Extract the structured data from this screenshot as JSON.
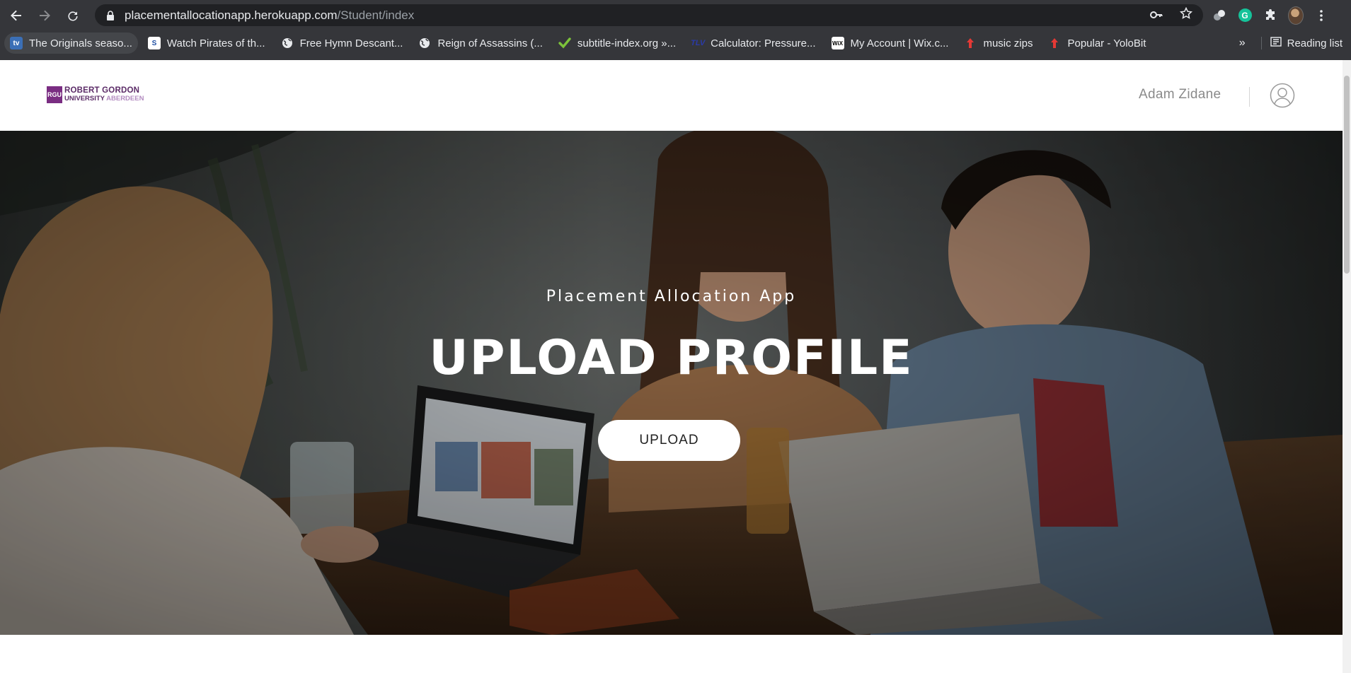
{
  "browser": {
    "url_host": "placementallocationapp.herokuapp.com",
    "url_path": "/Student/index",
    "nav_icons": [
      "back-arrow-icon",
      "forward-arrow-icon",
      "reload-icon"
    ],
    "bookmarks": [
      {
        "label": "The Originals seaso...",
        "icon": "tv-favicon",
        "color": "#3b6fb6"
      },
      {
        "label": "Watch Pirates of th...",
        "icon": "s-favicon",
        "color": "#1f4fa3"
      },
      {
        "label": "Free Hymn Descant...",
        "icon": "globe-icon",
        "color": "#e8eaed"
      },
      {
        "label": "Reign of Assassins (...",
        "icon": "globe-icon",
        "color": "#e8eaed"
      },
      {
        "label": "subtitle-index.org »...",
        "icon": "checkmark-icon",
        "color": "#7cc33a"
      },
      {
        "label": "Calculator: Pressure...",
        "icon": "tlv-favicon",
        "color": "#2a3aa8"
      },
      {
        "label": "My Account | Wix.c...",
        "icon": "wix-favicon",
        "color": "#ffffff"
      },
      {
        "label": "music zips",
        "icon": "up-arrow-icon",
        "color": "#e53935"
      },
      {
        "label": "Popular - YoloBit",
        "icon": "up-arrow-icon",
        "color": "#e53935"
      }
    ],
    "more_bookmarks": "»",
    "reading_list": "Reading list"
  },
  "site": {
    "logo_line1": "ROBERT GORDON",
    "logo_line2a": "UNIVERSITY",
    "logo_line2b": "ABERDEEN",
    "logo_badge": "RGU",
    "user_name": "Adam Zidane"
  },
  "hero": {
    "subtitle": "Placement Allocation App",
    "title": "UPLOAD PROFILE",
    "button_label": "UPLOAD"
  },
  "colors": {
    "chrome_bg": "#35363a",
    "omnibox_bg": "#202124",
    "brand_purple": "#7a2d82",
    "hero_text": "#ffffff"
  }
}
